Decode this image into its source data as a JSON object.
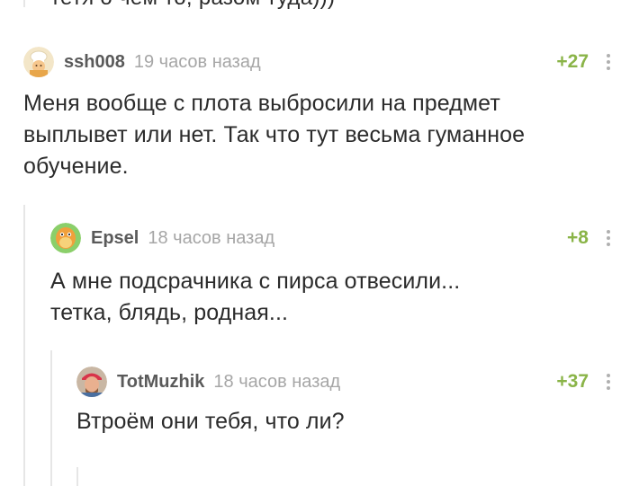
{
  "previous_comment": {
    "cut_text": "тетя о чем то, разом туда)))"
  },
  "comments": [
    {
      "author": "ssh008",
      "time": "19 часов назад",
      "rating": "+27",
      "avatar_icon": "chef-avatar",
      "lines": [
        "Меня вообще с плота выбросили на предмет",
        "выплывет или нет. Так что тут весьма гуманное",
        "обучение."
      ]
    },
    {
      "author": "Epsel",
      "time": "18 часов назад",
      "rating": "+8",
      "avatar_icon": "dino-avatar",
      "lines": [
        "А мне подсрачника с пирса отвесили...",
        "тетка, блядь, родная..."
      ]
    },
    {
      "author": "TotMuzhik",
      "time": "18 часов назад",
      "rating": "+37",
      "avatar_icon": "photo-avatar",
      "lines": [
        "Втроём они тебя, что ли?"
      ]
    }
  ],
  "colors": {
    "rating": "#8ab448",
    "author": "#5a5a5a",
    "time": "#a6a6a6",
    "thread_line": "#e6e6e6"
  }
}
